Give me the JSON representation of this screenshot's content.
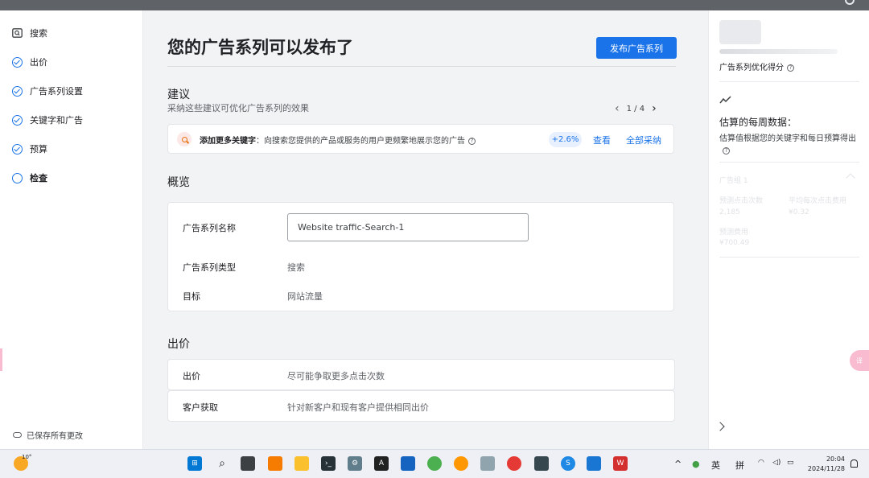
{
  "nav": {
    "items": [
      {
        "label": "搜索",
        "icon": "search-box-icon",
        "state": "search"
      },
      {
        "label": "出价",
        "icon": "check-circle-icon",
        "state": "done"
      },
      {
        "label": "广告系列设置",
        "icon": "check-circle-icon",
        "state": "done"
      },
      {
        "label": "关键字和广告",
        "icon": "check-circle-icon",
        "state": "done"
      },
      {
        "label": "预算",
        "icon": "check-circle-icon",
        "state": "done"
      },
      {
        "label": "检查",
        "icon": "circle-icon",
        "state": "current"
      }
    ],
    "saved_label": "已保存所有更改"
  },
  "main": {
    "title": "您的广告系列可以发布了",
    "publish_label": "发布广告系列",
    "suggestions": {
      "heading": "建议",
      "subtitle": "采纳这些建议可优化广告系列的效果",
      "pager": "1 / 4",
      "item": {
        "title": "添加更多关键字",
        "text": "：向搜索您提供的产品或服务的用户更频繁地展示您的广告",
        "uplift": "+2.6%",
        "view_label": "查看",
        "apply_all_label": "全部采纳"
      }
    },
    "overview": {
      "heading": "概览",
      "name_label": "广告系列名称",
      "name_value": "Website traffic-Search-1",
      "type_label": "广告系列类型",
      "type_value": "搜索",
      "goal_label": "目标",
      "goal_value": "网站流量"
    },
    "bidding": {
      "heading": "出价",
      "rows": [
        {
          "label": "出价",
          "value": "尽可能争取更多点击次数"
        },
        {
          "label": "客户获取",
          "value": "针对新客户和现有客户提供相同出价"
        }
      ]
    }
  },
  "right": {
    "score_label": "广告系列优化得分",
    "weekly_heading": "估算的每周数据：",
    "weekly_desc": "估算值根据您的关键字和每日预算得出",
    "group_label": "广告组 1",
    "clicks_label": "预测点击次数",
    "clicks_value": "2,185",
    "cpc_label": "平均每次点击费用",
    "cpc_value": "¥0.32",
    "cost_label": "预测费用",
    "cost_value": "¥700.49"
  },
  "taskbar": {
    "weather": "10°",
    "ime_lang": "英",
    "ime_mode": "拼",
    "time": "20:04",
    "date": "2024/11/28"
  },
  "colors": {
    "accent": "#1a73e8",
    "background": "#f1f3f4",
    "badge_bg": "#e8f0fe"
  }
}
